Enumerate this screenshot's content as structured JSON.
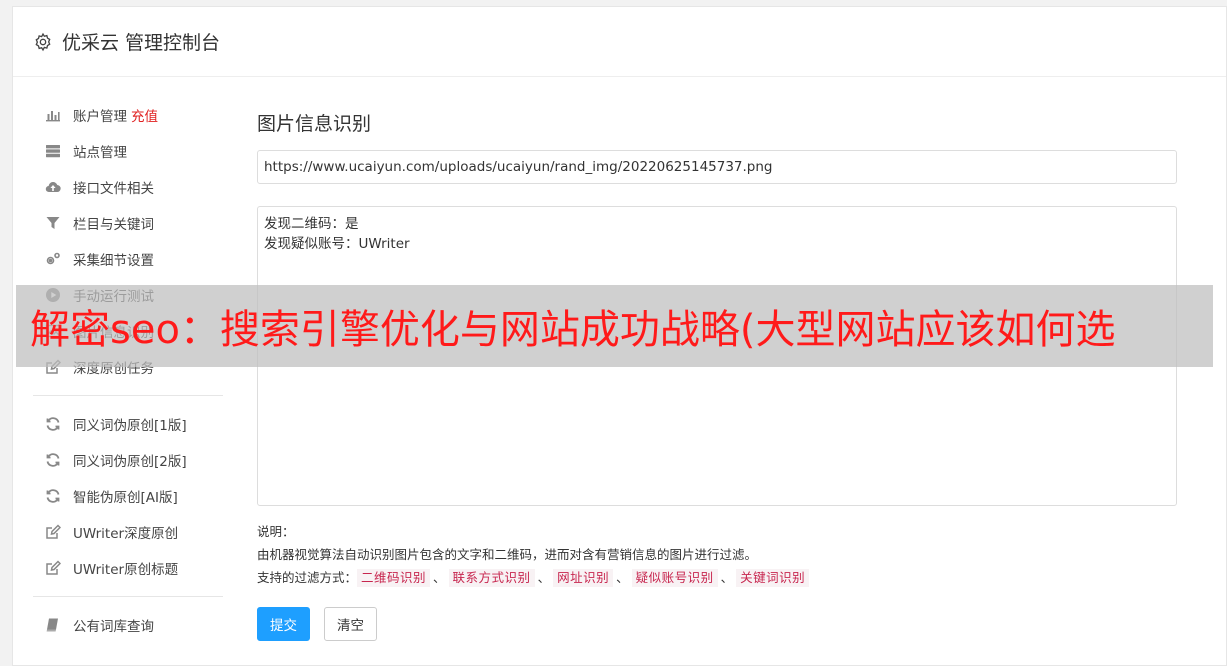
{
  "header": {
    "title": "优采云 管理控制台",
    "icon": "gear-icon"
  },
  "sidebar": {
    "group1": [
      {
        "label": "账户管理",
        "badge": "充值",
        "icon": "bar-chart-icon"
      },
      {
        "label": "站点管理",
        "icon": "server-icon"
      },
      {
        "label": "接口文件相关",
        "icon": "cloud-upload-icon"
      },
      {
        "label": "栏目与关键词",
        "icon": "filter-icon"
      },
      {
        "label": "采集细节设置",
        "icon": "cogs-icon"
      },
      {
        "label": "手动运行测试",
        "icon": "play-circle-icon"
      },
      {
        "label": "图片信息识别",
        "icon": "image-icon"
      },
      {
        "label": "深度原创任务",
        "icon": "edit-icon"
      }
    ],
    "group2": [
      {
        "label": "同义词伪原创[1版]",
        "icon": "refresh-icon"
      },
      {
        "label": "同义词伪原创[2版]",
        "icon": "refresh-icon"
      },
      {
        "label": "智能伪原创[AI版]",
        "icon": "refresh-icon"
      },
      {
        "label": "UWriter深度原创",
        "icon": "edit-icon"
      },
      {
        "label": "UWriter原创标题",
        "icon": "edit-icon"
      }
    ],
    "group3": [
      {
        "label": "公有词库查询",
        "icon": "book-icon"
      }
    ]
  },
  "main": {
    "title": "图片信息识别",
    "url_value": "https://www.ucaiyun.com/uploads/ucaiyun/rand_img/20220625145737.png",
    "result_lines": [
      "发现二维码：是",
      "发现疑似账号：UWriter"
    ],
    "notes_label": "说明：",
    "notes_text": "由机器视觉算法自动识别图片包含的文字和二维码，进而对含有营销信息的图片进行过滤。",
    "filters_label": "支持的过滤方式：",
    "filters": [
      "二维码识别",
      "联系方式识别",
      "网址识别",
      "疑似账号识别",
      "关键词识别"
    ],
    "filter_separator": "、",
    "submit_label": "提交",
    "clear_label": "清空"
  },
  "banner": {
    "text": "解密seo：搜索引擎优化与网站成功战略(大型网站应该如何选"
  },
  "colors": {
    "primary": "#1e9fff",
    "badge_red": "#e02020",
    "banner_text": "#ff1a1a",
    "tag_text": "#c7254e"
  }
}
